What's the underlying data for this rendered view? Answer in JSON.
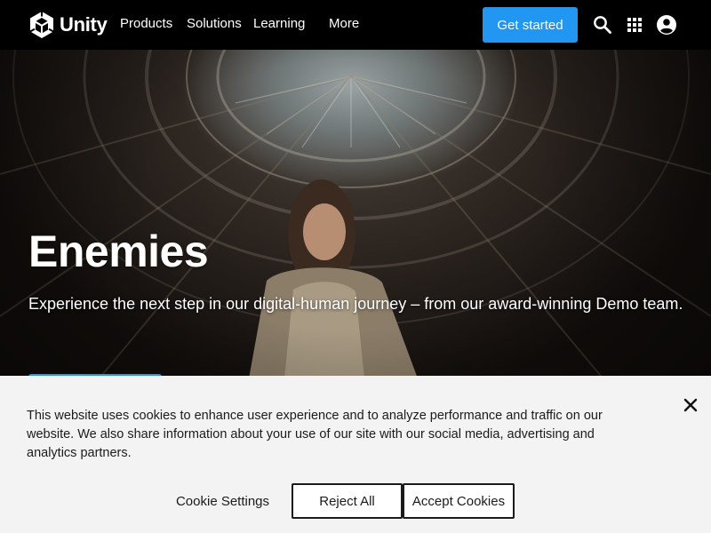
{
  "colors": {
    "accent": "#2196f3",
    "nav_bg": "#000000",
    "banner_bg": "#f3f3f3"
  },
  "header": {
    "brand": "Unity",
    "logo_icon": "unity-cube-icon",
    "links": [
      "Products",
      "Solutions",
      "Learning",
      "More"
    ],
    "cta_label": "Get started",
    "icons": [
      "search-icon",
      "apps-grid-icon",
      "account-icon"
    ]
  },
  "hero": {
    "title": "Enemies",
    "subtitle": "Experience the next step in our digital-human journey – from our award-winning Demo team."
  },
  "cookie_banner": {
    "text": "This website uses cookies to enhance user experience and to analyze performance and traffic on our website. We also share information about your use of our site with our social media, advertising and analytics partners.",
    "settings_label": "Cookie Settings",
    "reject_label": "Reject All",
    "accept_label": "Accept Cookies",
    "close_icon": "close-icon"
  }
}
